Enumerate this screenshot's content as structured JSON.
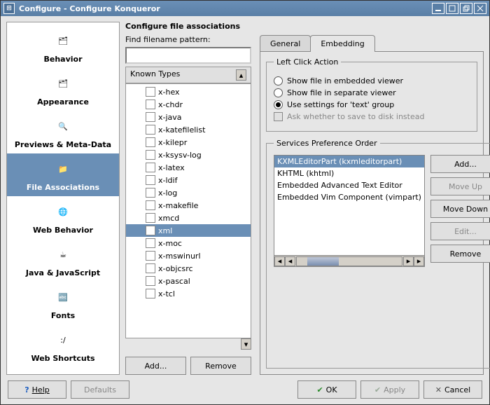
{
  "window": {
    "title": "Configure - Configure Konqueror"
  },
  "categories": [
    {
      "key": "behavior",
      "label": "Behavior"
    },
    {
      "key": "appearance",
      "label": "Appearance"
    },
    {
      "key": "previews",
      "label": "Previews & Meta-Data"
    },
    {
      "key": "file-assoc",
      "label": "File Associations",
      "selected": true
    },
    {
      "key": "web-behavior",
      "label": "Web Behavior"
    },
    {
      "key": "java-js",
      "label": "Java & JavaScript"
    },
    {
      "key": "fonts",
      "label": "Fonts"
    },
    {
      "key": "web-shortcuts",
      "label": "Web Shortcuts"
    }
  ],
  "panel": {
    "title": "Configure file associations",
    "find_label": "Find filename pattern:",
    "find_value": "",
    "known_types_header": "Known Types",
    "types": [
      "x-hex",
      "x-chdr",
      "x-java",
      "x-katefilelist",
      "x-kilepr",
      "x-ksysv-log",
      "x-latex",
      "x-ldif",
      "x-log",
      "x-makefile",
      "xmcd",
      "xml",
      "x-moc",
      "x-mswinurl",
      "x-objcsrc",
      "x-pascal",
      "x-tcl"
    ],
    "selected_type": "xml",
    "add_label": "Add...",
    "remove_label": "Remove"
  },
  "tabs": {
    "general": "General",
    "embedding": "Embedding",
    "active": "embedding"
  },
  "left_click": {
    "legend": "Left Click Action",
    "opt_embedded": "Show file in embedded viewer",
    "opt_separate": "Show file in separate viewer",
    "opt_group": "Use settings for 'text' group",
    "opt_ask": "Ask whether to save to disk instead",
    "selected": "opt_group"
  },
  "services": {
    "legend": "Services Preference Order",
    "items": [
      "KXMLEditorPart (kxmleditorpart)",
      "KHTML (khtml)",
      "Embedded Advanced Text Editor",
      "Embedded Vim Component (vimpart)"
    ],
    "selected_index": 0,
    "btn_add": "Add...",
    "btn_moveup": "Move Up",
    "btn_movedown": "Move Down",
    "btn_edit": "Edit...",
    "btn_remove": "Remove"
  },
  "footer": {
    "help": "Help",
    "defaults": "Defaults",
    "ok": "OK",
    "apply": "Apply",
    "cancel": "Cancel"
  }
}
